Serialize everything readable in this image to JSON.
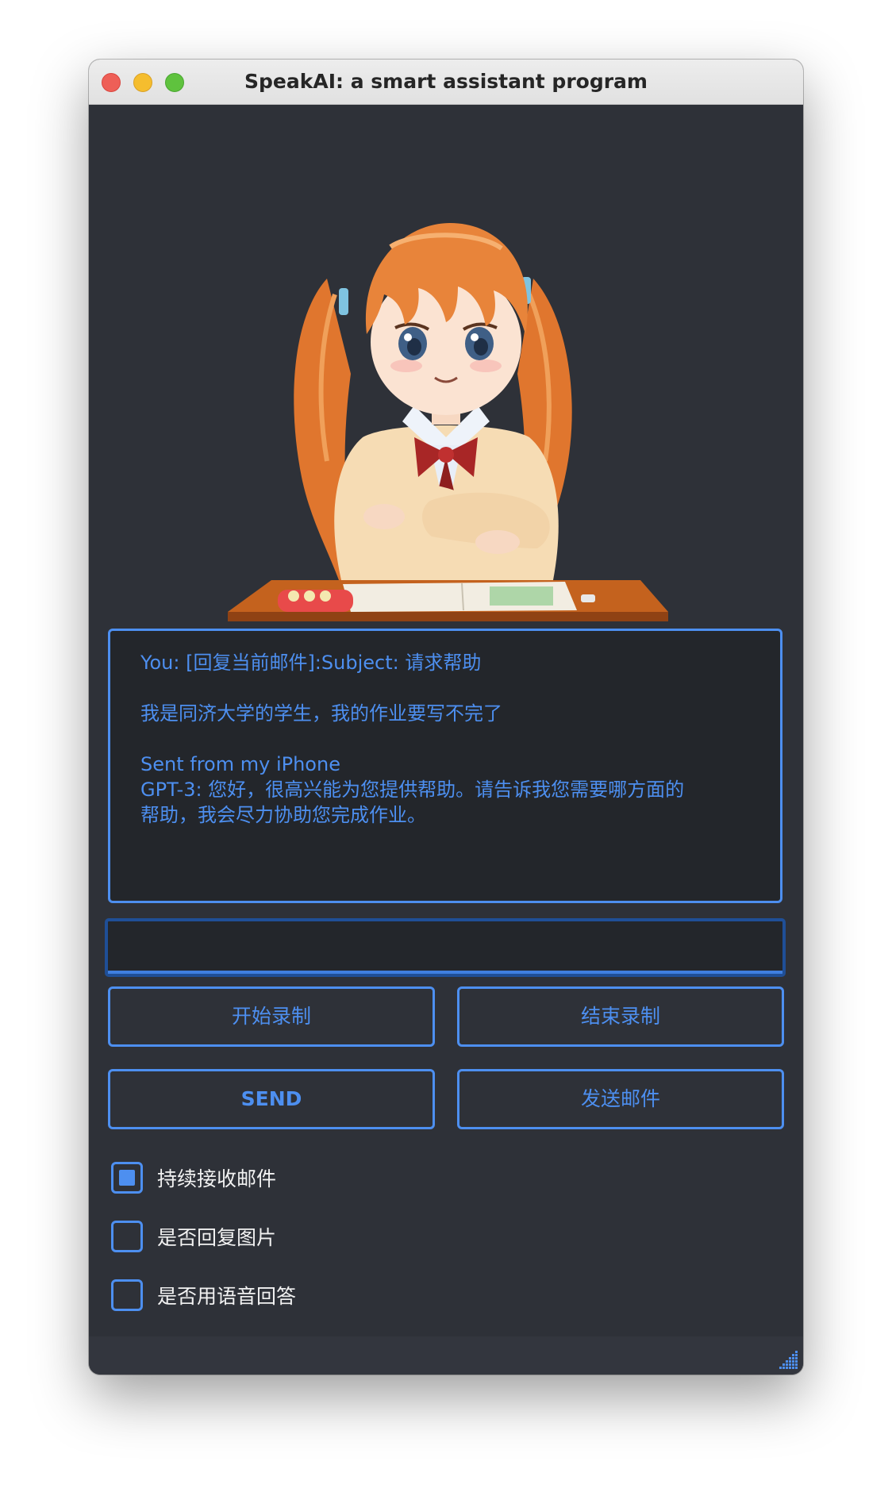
{
  "window": {
    "title": "SpeakAI: a smart assistant program",
    "traffic_lights": [
      "close",
      "minimize",
      "maximize"
    ]
  },
  "chat": {
    "lines": [
      "You: [回复当前邮件]:Subject: 请求帮助",
      "",
      "我是同济大学的学生，我的作业要写不完了",
      "",
      "Sent from my iPhone",
      "GPT-3: 您好，很高兴能为您提供帮助。请告诉我您需要哪方面的",
      "帮助，我会尽力协助您完成作业。"
    ]
  },
  "input": {
    "value": "",
    "placeholder": ""
  },
  "buttons": {
    "start_record": "开始录制",
    "stop_record": "结束录制",
    "send": "SEND",
    "send_email": "发送邮件"
  },
  "options": [
    {
      "label": "持续接收邮件",
      "checked": true
    },
    {
      "label": "是否回复图片",
      "checked": false
    },
    {
      "label": "是否用语音回答",
      "checked": false
    }
  ],
  "colors": {
    "accent": "#4d8ff0",
    "window_bg": "#2e3138",
    "chat_bg": "#23262b",
    "option_text": "#f2f2f2"
  },
  "icons": {
    "avatar": "anime-girl-at-desk-image",
    "resize": "resize-grip-icon"
  }
}
